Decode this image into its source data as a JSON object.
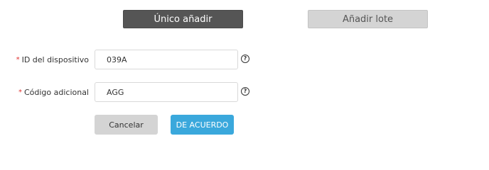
{
  "tabs": {
    "single_add": "Único añadir",
    "batch_add": "Añadir lote"
  },
  "form": {
    "device_id": {
      "label": "ID del dispositivo",
      "value": "039A"
    },
    "additional_code": {
      "label": "Código adicional",
      "value": "AGG"
    },
    "required_mark": "*",
    "help_icon": "question-circle-icon"
  },
  "actions": {
    "cancel_label": "Cancelar",
    "ok_label": "DE ACUERDO"
  },
  "colors": {
    "tab_active_bg": "#555555",
    "tab_inactive_bg": "#d4d4d4",
    "required": "#e0312f",
    "primary": "#3aa8dc",
    "secondary_button": "#d4d4d4"
  }
}
